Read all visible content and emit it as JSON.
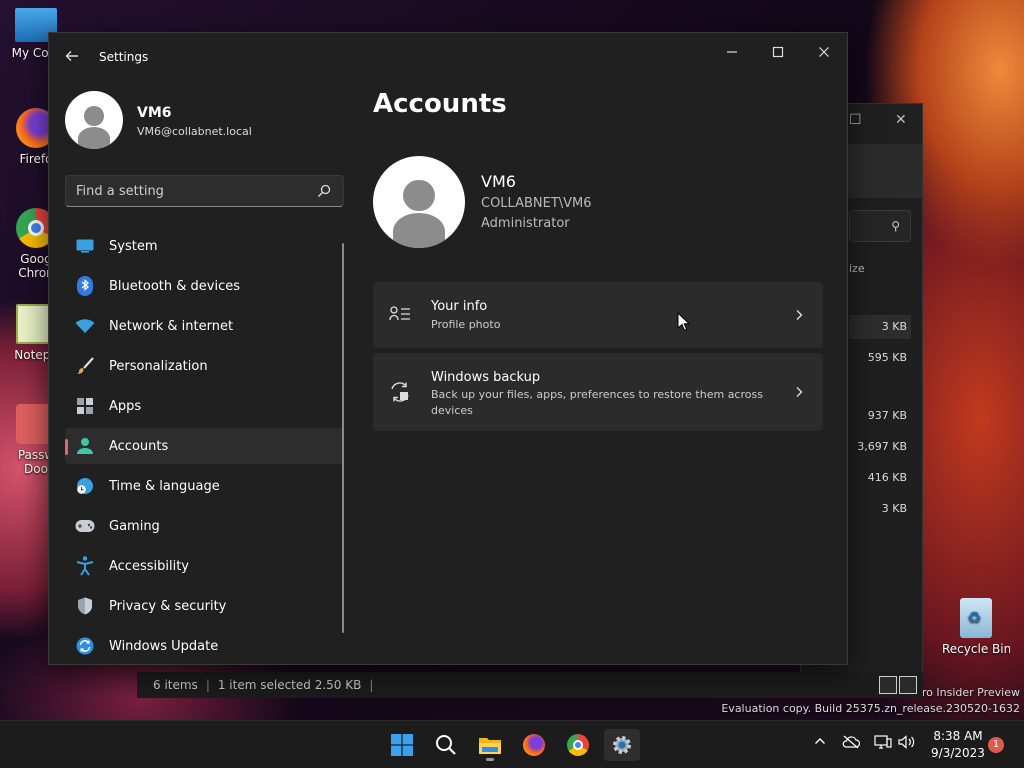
{
  "desktop": {
    "icons": [
      {
        "label": "My Com"
      },
      {
        "label": "Firefo"
      },
      {
        "label": "Goog Chron"
      },
      {
        "label": "Notepa"
      },
      {
        "label": "Passw Doo"
      },
      {
        "label": "Recycle Bin"
      }
    ],
    "watermark_line1": "Pro Insider Preview",
    "watermark_line2": "Evaluation copy. Build 25375.zn_release.230520-1632"
  },
  "explorer": {
    "column_header": "ize",
    "sizes": [
      "3 KB",
      "595 KB",
      "937 KB",
      "3,697 KB",
      "416 KB",
      "3 KB"
    ],
    "status_items": "6 items",
    "status_selected": "1 item selected  2.50 KB"
  },
  "settings": {
    "window_title": "Settings",
    "profile": {
      "name": "VM6",
      "email": "VM6@collabnet.local"
    },
    "search_placeholder": "Find a setting",
    "nav": [
      {
        "label": "System"
      },
      {
        "label": "Bluetooth & devices"
      },
      {
        "label": "Network & internet"
      },
      {
        "label": "Personalization"
      },
      {
        "label": "Apps"
      },
      {
        "label": "Accounts"
      },
      {
        "label": "Time & language"
      },
      {
        "label": "Gaming"
      },
      {
        "label": "Accessibility"
      },
      {
        "label": "Privacy & security"
      },
      {
        "label": "Windows Update"
      }
    ],
    "active_nav": "Accounts",
    "page_title": "Accounts",
    "account": {
      "name": "VM6",
      "domain": "COLLABNET\\VM6",
      "role": "Administrator"
    },
    "cards": [
      {
        "title": "Your info",
        "subtitle": "Profile photo"
      },
      {
        "title": "Windows backup",
        "subtitle": "Back up your files, apps, preferences to restore them across devices"
      }
    ]
  },
  "taskbar": {
    "time": "8:38 AM",
    "date": "9/3/2023",
    "notification_count": "1"
  },
  "colors": {
    "accent": "#d96a6a",
    "window_bg": "#202020",
    "card_bg": "#2b2b2b"
  }
}
